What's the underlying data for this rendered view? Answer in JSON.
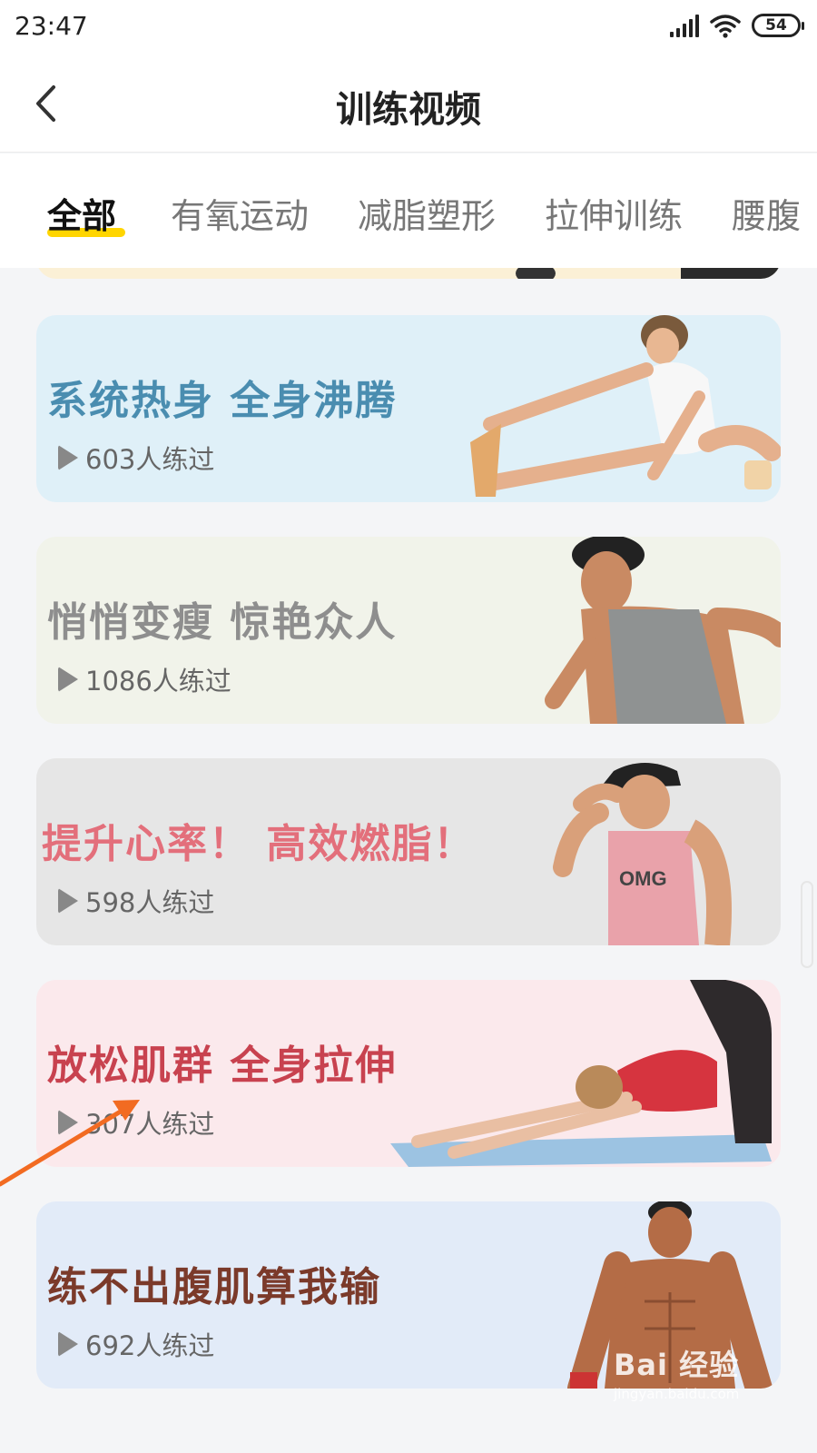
{
  "status_bar": {
    "time": "23:47",
    "battery": "54"
  },
  "header": {
    "title": "训练视频"
  },
  "tabs": [
    {
      "label": "全部",
      "active": true
    },
    {
      "label": "有氧运动"
    },
    {
      "label": "减脂塑形"
    },
    {
      "label": "拉伸训练"
    },
    {
      "label": "腰腹"
    }
  ],
  "cards": [
    {
      "title": "系统热身 全身沸腾",
      "count": "603人练过",
      "bg": "#dff0f8",
      "title_color": "#4a8db0",
      "photo": "woman-stretching"
    },
    {
      "title": "悄悄变瘦 惊艳众人",
      "count": "1086人练过",
      "bg": "#f1f3ea",
      "title_color": "#8e8e8e",
      "photo": "man-running"
    },
    {
      "title": "提升心率！ 高效燃脂！",
      "count": "598人练过",
      "bg": "#e6e6e6",
      "title_color": "#e36f7b",
      "photo": "man-cap"
    },
    {
      "title": "放松肌群 全身拉伸",
      "count": "307人练过",
      "bg": "#fbe9ec",
      "title_color": "#c8424f",
      "photo": "woman-yoga"
    },
    {
      "title": "练不出腹肌算我输",
      "count": "692人练过",
      "bg": "#e2ebf8",
      "title_color": "#7b3a2a",
      "photo": "man-shirtless"
    }
  ],
  "watermark": {
    "main": "Bai 经验",
    "sub": "jingyan.baidu.com"
  },
  "colors": {
    "accent": "#ffd500",
    "arrow": "#f26b22"
  }
}
